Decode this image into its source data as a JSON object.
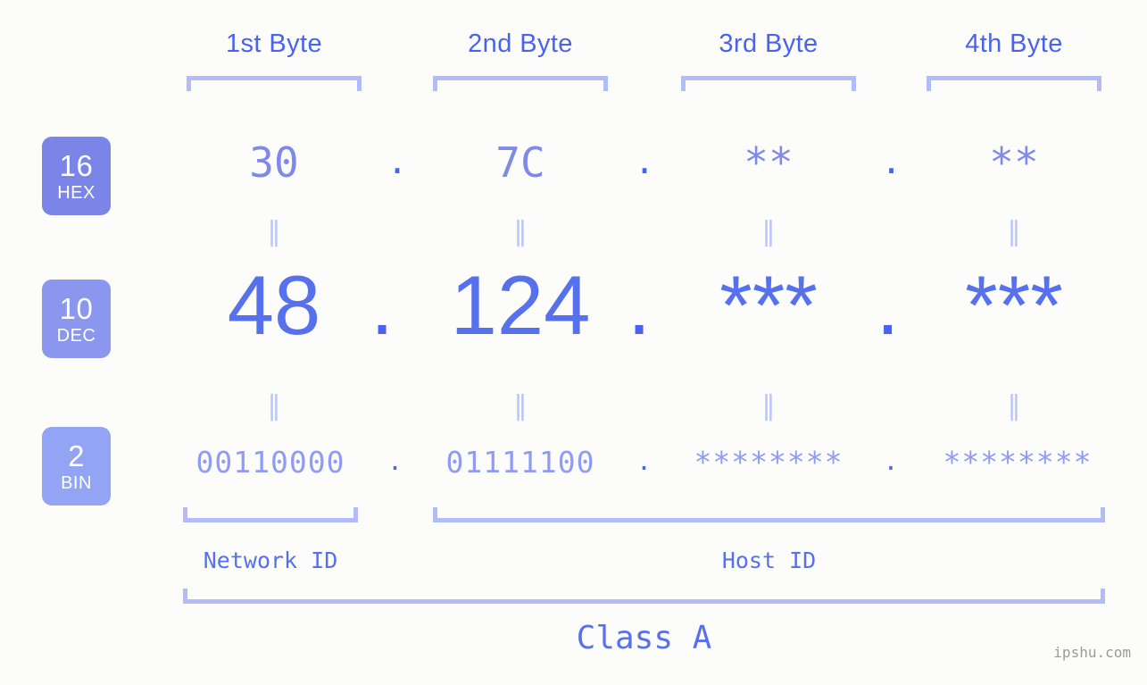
{
  "meta": {
    "watermark": "ipshu.com",
    "background_color": "#fcfdfa",
    "accent_color": "#5770ec",
    "bracket_color": "#b2bcfb",
    "separator_color": "#bcc5fb"
  },
  "header": {
    "bytes": [
      {
        "label": "1st Byte"
      },
      {
        "label": "2nd Byte"
      },
      {
        "label": "3rd Byte"
      },
      {
        "label": "4th Byte"
      }
    ]
  },
  "bases": [
    {
      "number": "16",
      "abbr": "HEX",
      "color": "#7b85e8"
    },
    {
      "number": "10",
      "abbr": "DEC",
      "color": "#8b96ee"
    },
    {
      "number": "2",
      "abbr": "BIN",
      "color": "#93a4f5"
    }
  ],
  "rows": {
    "hex": {
      "values": [
        "30",
        "7C",
        "**",
        "**"
      ],
      "separator": "."
    },
    "dec": {
      "values": [
        "48",
        "124",
        "***",
        "***"
      ],
      "separator": "."
    },
    "bin": {
      "values": [
        "00110000",
        "01111100",
        "********",
        "********"
      ],
      "separator": "."
    }
  },
  "separators": {
    "equals": "‖"
  },
  "regions": [
    {
      "label": "Network ID"
    },
    {
      "label": "Host ID"
    }
  ],
  "class": {
    "label": "Class A"
  }
}
